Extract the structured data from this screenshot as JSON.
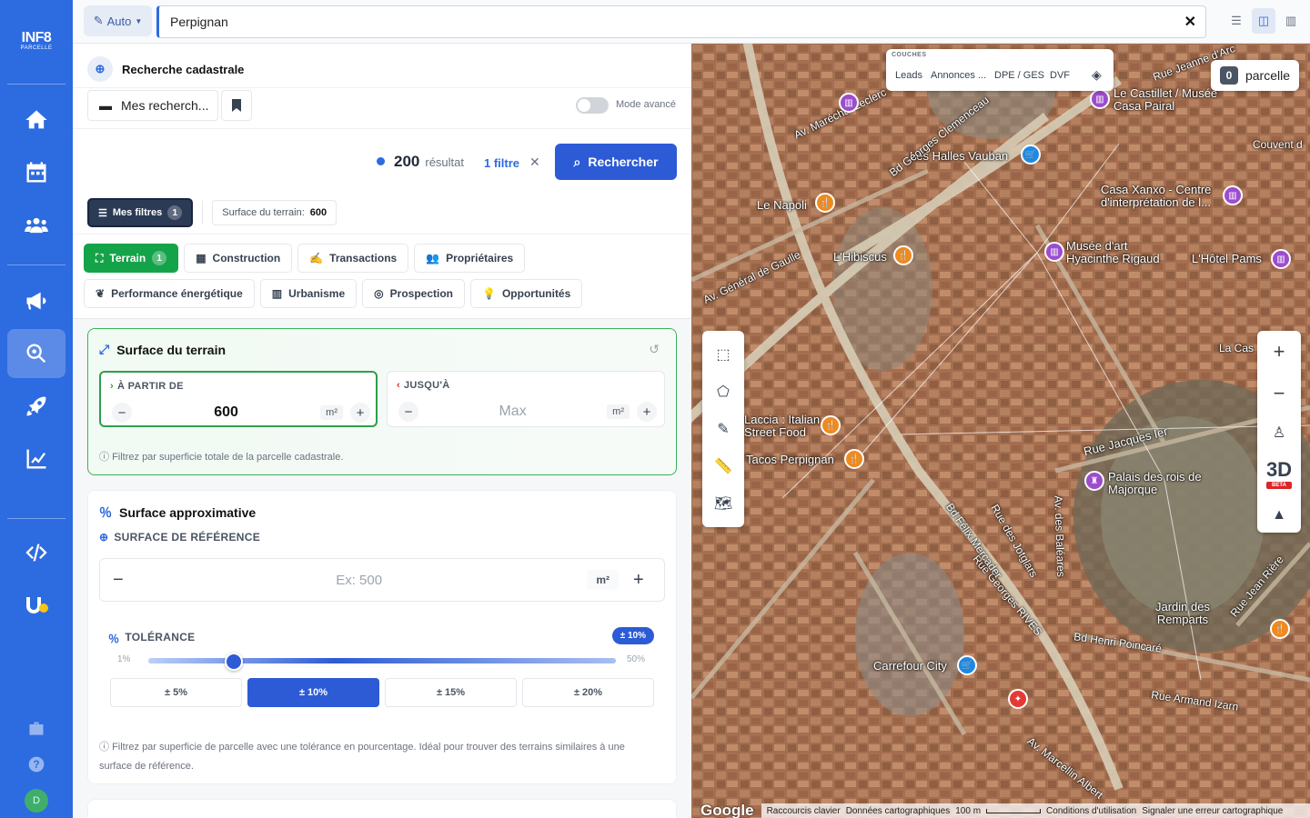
{
  "sidebar": {
    "logo_line1": "INF8",
    "logo_line2": "PARCELLE",
    "avatar_initial": "D"
  },
  "topbar": {
    "auto_label": "Auto",
    "search_value": "Perpignan",
    "clear_symbol": "✕"
  },
  "panel": {
    "title": "Recherche cadastrale",
    "my_searches": "Mes recherch...",
    "advanced_mode": "Mode avancé",
    "result_count": "200",
    "result_label": "résultat",
    "filter_count": "1 filtre",
    "search_button": "Rechercher",
    "my_filters": "Mes filtres",
    "my_filters_count": "1",
    "active_tag_label": "Surface du terrain:",
    "active_tag_value": "600",
    "tabs_row1": [
      {
        "label": "Terrain",
        "count": "1"
      },
      {
        "label": "Construction"
      },
      {
        "label": "Transactions"
      },
      {
        "label": "Propriétaires"
      }
    ],
    "tabs_row2": [
      {
        "label": "Performance énergétique"
      },
      {
        "label": "Urbanisme"
      },
      {
        "label": "Prospection"
      },
      {
        "label": "Opportunités"
      }
    ]
  },
  "surface_terrain": {
    "title": "Surface du terrain",
    "from_label": "À PARTIR DE",
    "from_value": "600",
    "to_label": "JUSQU'À",
    "to_placeholder": "Max",
    "unit": "m²",
    "hint": "Filtrez par superficie totale de la parcelle cadastrale."
  },
  "surface_approx": {
    "title": "Surface approximative",
    "ref_label": "SURFACE DE RÉFÉRENCE",
    "ref_placeholder": "Ex: 500",
    "unit": "m²",
    "tolerance_label": "TOLÉRANCE",
    "tolerance_badge": "± 10%",
    "slider_min": "1%",
    "slider_max": "50%",
    "tolerance_value_percent": 10,
    "presets": [
      "± 5%",
      "± 10%",
      "± 15%",
      "± 20%"
    ],
    "selected_preset": 1,
    "hint": "Filtrez par superficie de parcelle avec une tolérance en pourcentage. Idéal pour trouver des terrains similaires à une surface de référence."
  },
  "map": {
    "layers_title": "COUCHES",
    "layers": [
      "Leads",
      "Annonces ...",
      "DPE / GES",
      "DVF"
    ],
    "parcel_count": "0",
    "parcel_label": "parcelle",
    "labels": [
      "Les Halles Vauban",
      "Le Castillet / Musée Casa Pairal",
      "Casa Xanxo - Centre d'interprétation de l...",
      "Musée d'art Hyacinthe Rigaud",
      "L'Hôtel Pams",
      "Le Napoli",
      "L'Hibiscus",
      "Laccia : Italian Street Food",
      "Tacos Perpignan",
      "Palais des rois de Majorque",
      "Carrefour City",
      "Jardin des Remparts",
      "Rue Jacques Ier",
      "Bd Henri Poincaré",
      "Rue Armand Izarn",
      "Av. Maréchal Leclerc",
      "Bd Georges Clemenceau",
      "Av. Général de Gaulle",
      "Rue Jeanne d'Arc",
      "Couvent d",
      "La Cas",
      "Av. des Baléares",
      "Rue Jean Rière",
      "Av. Marcellin Albert",
      "Rue des Jotglars",
      "Rue Georges RIVES",
      "Bd Félix Mercader"
    ],
    "zoom_in": "+",
    "zoom_out": "−",
    "three_d": "3D",
    "beta": "BETA",
    "google": "Google",
    "attrib": [
      "Raccourcis clavier",
      "Données cartographiques",
      "100 m",
      "Conditions d'utilisation",
      "Signaler une erreur cartographique"
    ]
  }
}
